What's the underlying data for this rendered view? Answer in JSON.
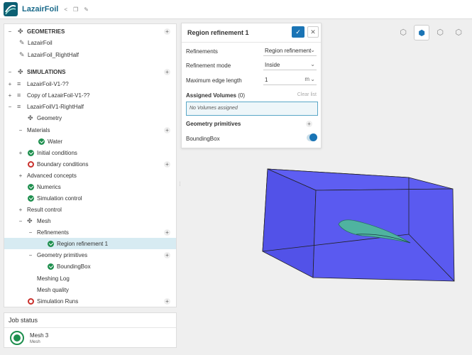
{
  "app": {
    "title": "LazairFoil"
  },
  "tree": {
    "geometries_header": "GEOMETRIES",
    "geometry_1": "LazairFoil",
    "geometry_2": "LazairFoil_RightHalf",
    "simulations_header": "SIMULATIONS",
    "sim_1": "LazairFoil-V1-??",
    "sim_2": "Copy of LazairFoil-V1-??",
    "sim_3": "LazairFoilV1-RightHalf",
    "geometry": "Geometry",
    "materials": "Materials",
    "water": "Water",
    "initial_conditions": "Initial conditions",
    "boundary_conditions": "Boundary conditions",
    "advanced_concepts": "Advanced concepts",
    "numerics": "Numerics",
    "simulation_control": "Simulation control",
    "result_control": "Result control",
    "mesh": "Mesh",
    "refinements": "Refinements",
    "region_refinement": "Region refinement 1",
    "geometry_primitives": "Geometry primitives",
    "bounding_box": "BoundingBox",
    "meshing_log": "Meshing Log",
    "mesh_quality": "Mesh quality",
    "simulation_runs": "Simulation Runs"
  },
  "job": {
    "title": "Job status",
    "name": "Mesh 3",
    "sub": "Mesh"
  },
  "panel": {
    "title": "Region refinement 1",
    "refinements_label": "Refinements",
    "refinements_value": "Region refinement",
    "mode_label": "Refinement mode",
    "mode_value": "Inside",
    "edge_label": "Maximum edge length",
    "edge_value": "1",
    "edge_unit": "m",
    "assigned_label": "Assigned Volumes",
    "assigned_count": "(0)",
    "clear_list": "Clear list",
    "no_volumes": "No Volumes assigned",
    "geo_primitives": "Geometry primitives",
    "bounding_box": "BoundingBox",
    "bounding_box_visible": true
  },
  "colors": {
    "accent": "#1a74b5",
    "box": "#5a5af0",
    "airfoil": "#4fb3a0",
    "ok": "#1e8f4e",
    "error": "#c9302c"
  },
  "icons": [
    "share-icon",
    "copy-icon",
    "edit-icon",
    "check-icon",
    "close-icon",
    "chevron-down-icon",
    "plus-icon",
    "cube-icon"
  ]
}
